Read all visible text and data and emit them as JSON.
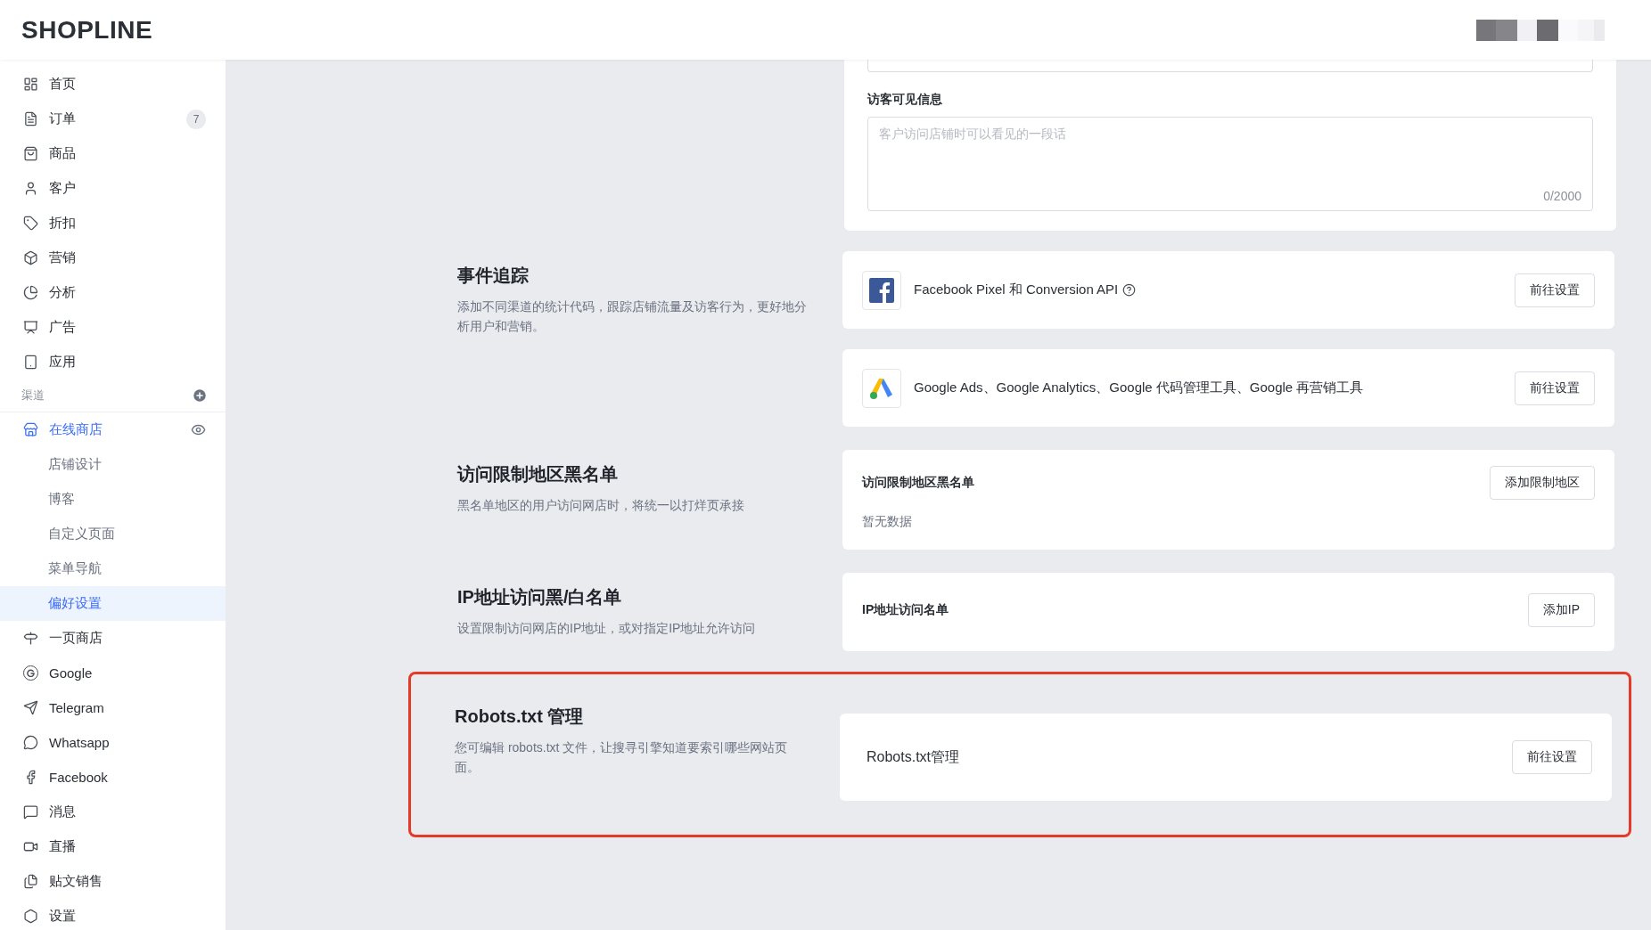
{
  "header": {
    "logo": "SHOPLINE"
  },
  "sidebar": {
    "items": [
      {
        "label": "首页",
        "selected": false
      },
      {
        "label": "订单",
        "selected": false,
        "badge": "7"
      },
      {
        "label": "商品",
        "selected": false
      },
      {
        "label": "客户",
        "selected": false
      },
      {
        "label": "折扣",
        "selected": false
      },
      {
        "label": "营销",
        "selected": false
      },
      {
        "label": "分析",
        "selected": false
      },
      {
        "label": "广告",
        "selected": false
      },
      {
        "label": "应用",
        "selected": false
      }
    ],
    "channels_heading": "渠道",
    "channels": [
      {
        "label": "在线商店",
        "selected": true,
        "children": [
          {
            "label": "店铺设计",
            "selected": false
          },
          {
            "label": "博客",
            "selected": false
          },
          {
            "label": "自定义页面",
            "selected": false
          },
          {
            "label": "菜单导航",
            "selected": false
          },
          {
            "label": "偏好设置",
            "selected": true
          }
        ]
      },
      {
        "label": "一页商店",
        "selected": false
      },
      {
        "label": "Google",
        "selected": false
      },
      {
        "label": "Telegram",
        "selected": false
      },
      {
        "label": "Whatsapp",
        "selected": false
      },
      {
        "label": "Facebook",
        "selected": false
      },
      {
        "label": "消息",
        "selected": false
      },
      {
        "label": "直播",
        "selected": false
      },
      {
        "label": "贴文销售",
        "selected": false
      },
      {
        "label": "设置",
        "selected": false
      }
    ]
  },
  "visitor_card": {
    "label": "访客可见信息",
    "placeholder": "客户访问店铺时可以看见的一段话",
    "counter": "0/2000"
  },
  "sections": [
    {
      "title": "事件追踪",
      "description": "添加不同渠道的统计代码，跟踪店铺流量及访客行为，更好地分析用户和营销。",
      "highlighted": false,
      "cards": [
        {
          "kind": "integration",
          "label": "Facebook Pixel 和 Conversion API",
          "help": true,
          "button": "前往设置"
        },
        {
          "kind": "integration",
          "label": "Google Ads、Google Analytics、Google 代码管理工具、Google 再营销工具",
          "help": false,
          "button": "前往设置"
        }
      ]
    },
    {
      "title": "访问限制地区黑名单",
      "description": "黑名单地区的用户访问网店时，将统一以打烊页承接",
      "highlighted": false,
      "cards": [
        {
          "kind": "list",
          "label": "访问限制地区黑名单",
          "button": "添加限制地区",
          "empty": "暂无数据"
        }
      ]
    },
    {
      "title": "IP地址访问黑/白名单",
      "description": "设置限制访问网店的IP地址，或对指定IP地址允许访问",
      "highlighted": false,
      "cards": [
        {
          "kind": "list",
          "label": "IP地址访问名单",
          "button": "添加IP"
        }
      ]
    },
    {
      "title": "Robots.txt 管理",
      "description": "您可编辑 robots.txt 文件，让搜寻引擎知道要索引哪些网站页面。",
      "highlighted": true,
      "cards": [
        {
          "kind": "link",
          "label": "Robots.txt管理",
          "button": "前往设置"
        }
      ]
    }
  ]
}
